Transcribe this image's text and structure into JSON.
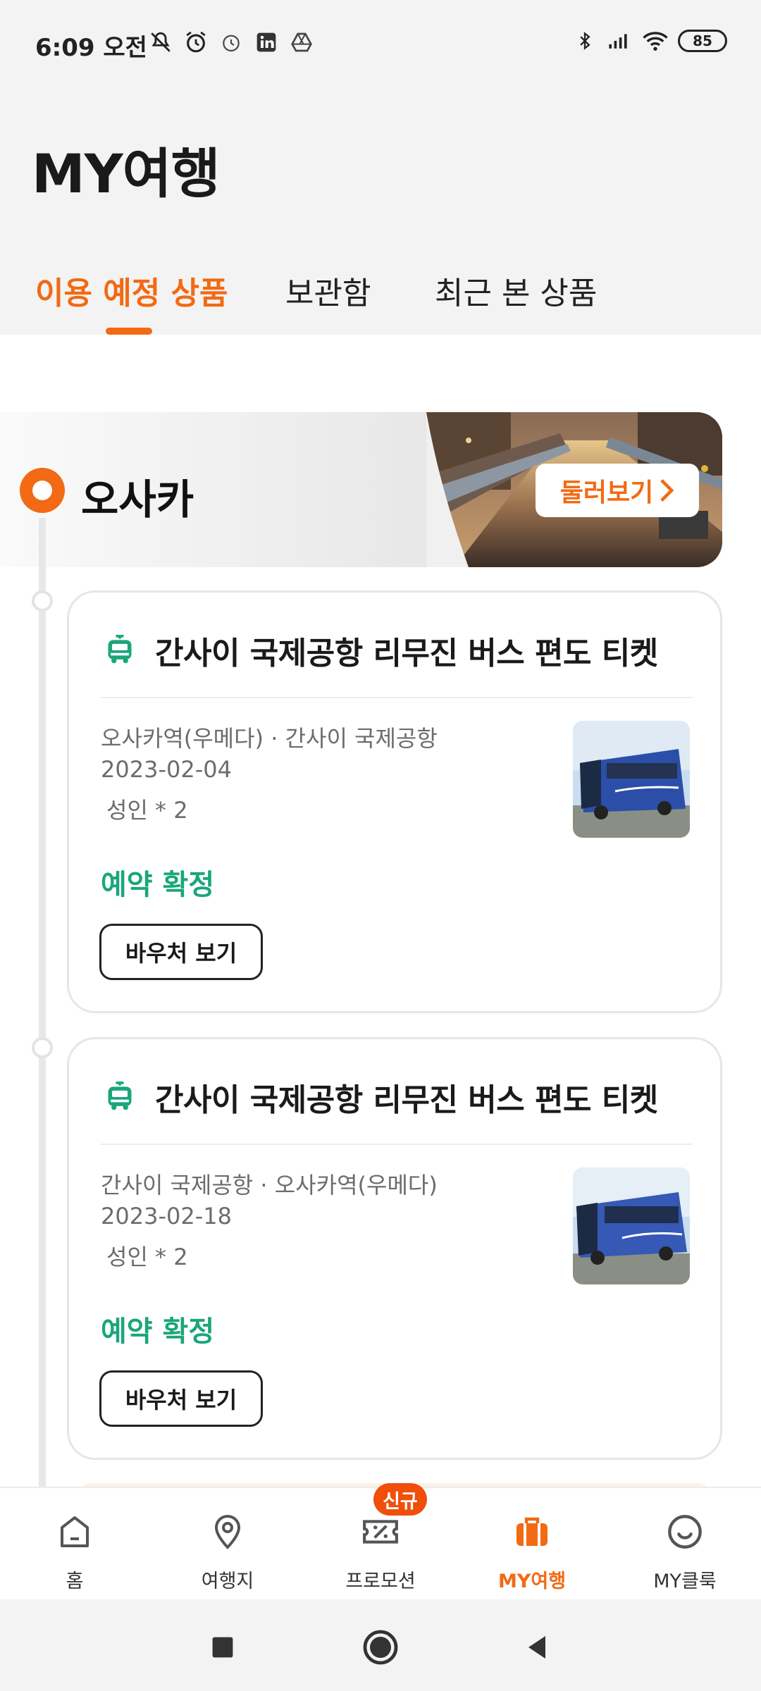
{
  "status_bar": {
    "time": "6:09 오전",
    "battery": "85",
    "icons_left": [
      "mute-icon",
      "alarm-icon",
      "alarm-outline-icon",
      "linkedin-icon",
      "drive-icon"
    ],
    "icons_right": [
      "bluetooth-icon",
      "signal-icon",
      "wifi-icon",
      "battery-icon"
    ]
  },
  "header": {
    "title": "MY여행"
  },
  "tabs": [
    {
      "label": "이용 예정 상품",
      "active": true
    },
    {
      "label": "보관함",
      "active": false
    },
    {
      "label": "최근 본 상품",
      "active": false
    }
  ],
  "city": {
    "name": "오사카",
    "browse_label": "둘러보기"
  },
  "bookings": [
    {
      "title": "간사이 국제공항 리무진 버스 편도 티켓",
      "route": "오사카역(우메다) · 간사이 국제공항",
      "date": "2023-02-04",
      "pax": "성인 * 2",
      "status": "예약 확정",
      "voucher_label": "바우처 보기"
    },
    {
      "title": "간사이 국제공항 리무진 버스 편도 티켓",
      "route": "간사이 국제공항 · 오사카역(우메다)",
      "date": "2023-02-18",
      "pax": "성인 * 2",
      "status": "예약 확정",
      "voucher_label": "바우처 보기"
    }
  ],
  "bottom_nav": {
    "items": [
      {
        "label": "홈",
        "icon": "home-icon",
        "active": false
      },
      {
        "label": "여행지",
        "icon": "location-pin-icon",
        "active": false
      },
      {
        "label": "프로모션",
        "icon": "coupon-icon",
        "active": false,
        "badge": "신규"
      },
      {
        "label": "MY여행",
        "icon": "suitcase-icon",
        "active": true
      },
      {
        "label": "MY클룩",
        "icon": "smiley-icon",
        "active": false
      }
    ]
  },
  "colors": {
    "accent": "#f26a13",
    "confirmed": "#1aa67b",
    "badge": "#f04e0b"
  }
}
